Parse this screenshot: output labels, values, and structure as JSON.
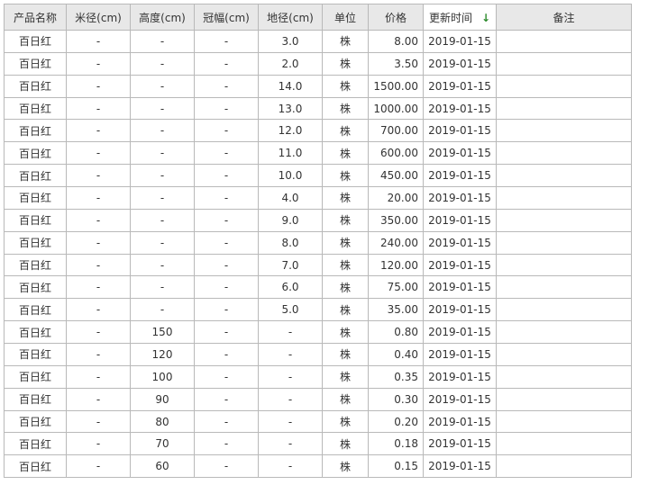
{
  "columns": [
    "产品名称",
    "米径(cm)",
    "高度(cm)",
    "冠幅(cm)",
    "地径(cm)",
    "单位",
    "价格",
    "更新时间",
    "备注"
  ],
  "sort_icon": "sort-down-arrow-icon",
  "rows": [
    [
      "百日红",
      "-",
      "-",
      "-",
      "3.0",
      "株",
      "8.00",
      "2019-01-15",
      ""
    ],
    [
      "百日红",
      "-",
      "-",
      "-",
      "2.0",
      "株",
      "3.50",
      "2019-01-15",
      ""
    ],
    [
      "百日红",
      "-",
      "-",
      "-",
      "14.0",
      "株",
      "1500.00",
      "2019-01-15",
      ""
    ],
    [
      "百日红",
      "-",
      "-",
      "-",
      "13.0",
      "株",
      "1000.00",
      "2019-01-15",
      ""
    ],
    [
      "百日红",
      "-",
      "-",
      "-",
      "12.0",
      "株",
      "700.00",
      "2019-01-15",
      ""
    ],
    [
      "百日红",
      "-",
      "-",
      "-",
      "11.0",
      "株",
      "600.00",
      "2019-01-15",
      ""
    ],
    [
      "百日红",
      "-",
      "-",
      "-",
      "10.0",
      "株",
      "450.00",
      "2019-01-15",
      ""
    ],
    [
      "百日红",
      "-",
      "-",
      "-",
      "4.0",
      "株",
      "20.00",
      "2019-01-15",
      ""
    ],
    [
      "百日红",
      "-",
      "-",
      "-",
      "9.0",
      "株",
      "350.00",
      "2019-01-15",
      ""
    ],
    [
      "百日红",
      "-",
      "-",
      "-",
      "8.0",
      "株",
      "240.00",
      "2019-01-15",
      ""
    ],
    [
      "百日红",
      "-",
      "-",
      "-",
      "7.0",
      "株",
      "120.00",
      "2019-01-15",
      ""
    ],
    [
      "百日红",
      "-",
      "-",
      "-",
      "6.0",
      "株",
      "75.00",
      "2019-01-15",
      ""
    ],
    [
      "百日红",
      "-",
      "-",
      "-",
      "5.0",
      "株",
      "35.00",
      "2019-01-15",
      ""
    ],
    [
      "百日红",
      "-",
      "150",
      "-",
      "-",
      "株",
      "0.80",
      "2019-01-15",
      ""
    ],
    [
      "百日红",
      "-",
      "120",
      "-",
      "-",
      "株",
      "0.40",
      "2019-01-15",
      ""
    ],
    [
      "百日红",
      "-",
      "100",
      "-",
      "-",
      "株",
      "0.35",
      "2019-01-15",
      ""
    ],
    [
      "百日红",
      "-",
      "90",
      "-",
      "-",
      "株",
      "0.30",
      "2019-01-15",
      ""
    ],
    [
      "百日红",
      "-",
      "80",
      "-",
      "-",
      "株",
      "0.20",
      "2019-01-15",
      ""
    ],
    [
      "百日红",
      "-",
      "70",
      "-",
      "-",
      "株",
      "0.18",
      "2019-01-15",
      ""
    ],
    [
      "百日红",
      "-",
      "60",
      "-",
      "-",
      "株",
      "0.15",
      "2019-01-15",
      ""
    ]
  ]
}
